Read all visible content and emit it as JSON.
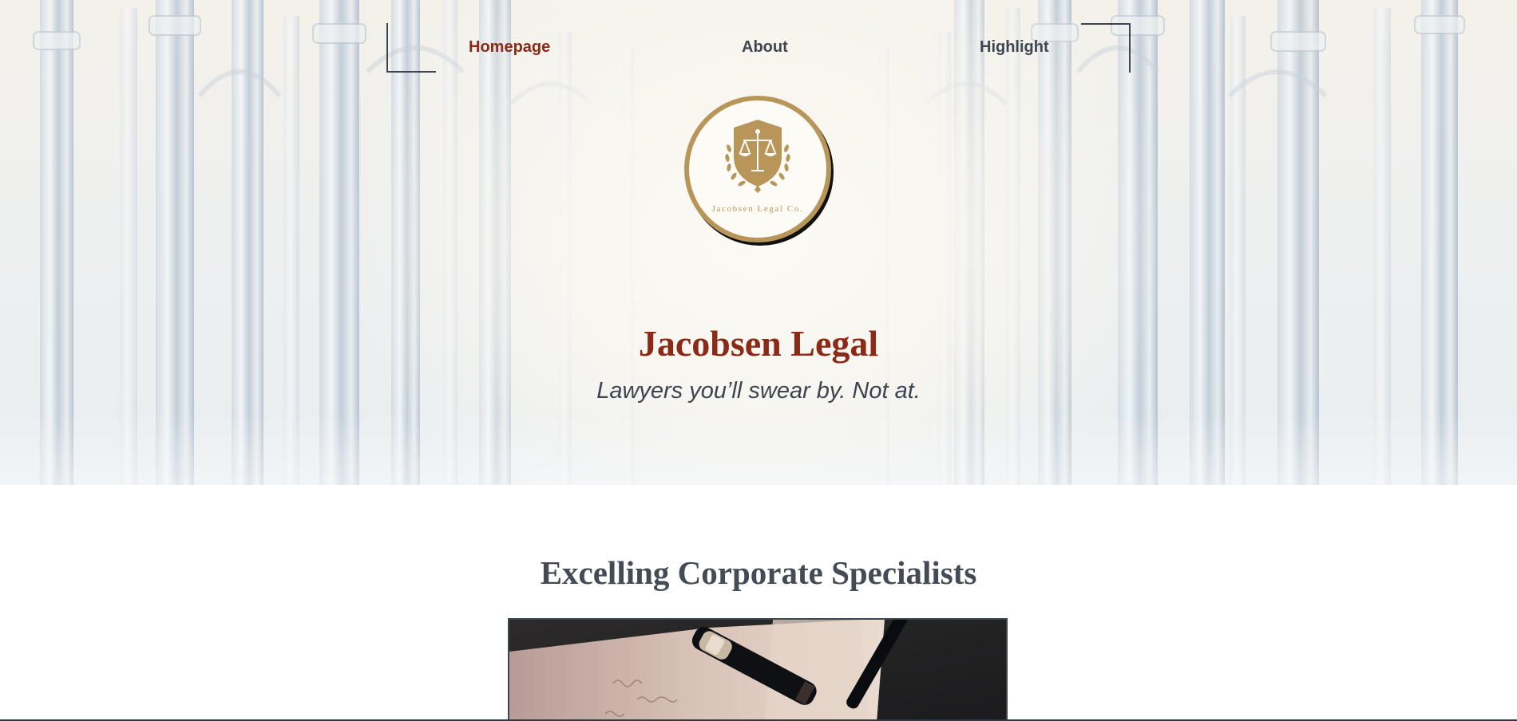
{
  "nav": {
    "items": [
      {
        "label": "Homepage",
        "active": true
      },
      {
        "label": "About",
        "active": false
      },
      {
        "label": "Highlight",
        "active": false
      }
    ]
  },
  "logo": {
    "text": "Jacobsen Legal Co.",
    "icon": "scales-of-justice-shield-icon",
    "color": "#b8965a"
  },
  "hero": {
    "title": "Jacobsen Legal",
    "tagline": "Lawyers you’ll swear by. Not at."
  },
  "section": {
    "title": "Excelling Corporate Specialists"
  },
  "colors": {
    "accent": "#8b2a16",
    "text": "#3f4650",
    "gold": "#b8965a",
    "frame": "#3b4650"
  }
}
